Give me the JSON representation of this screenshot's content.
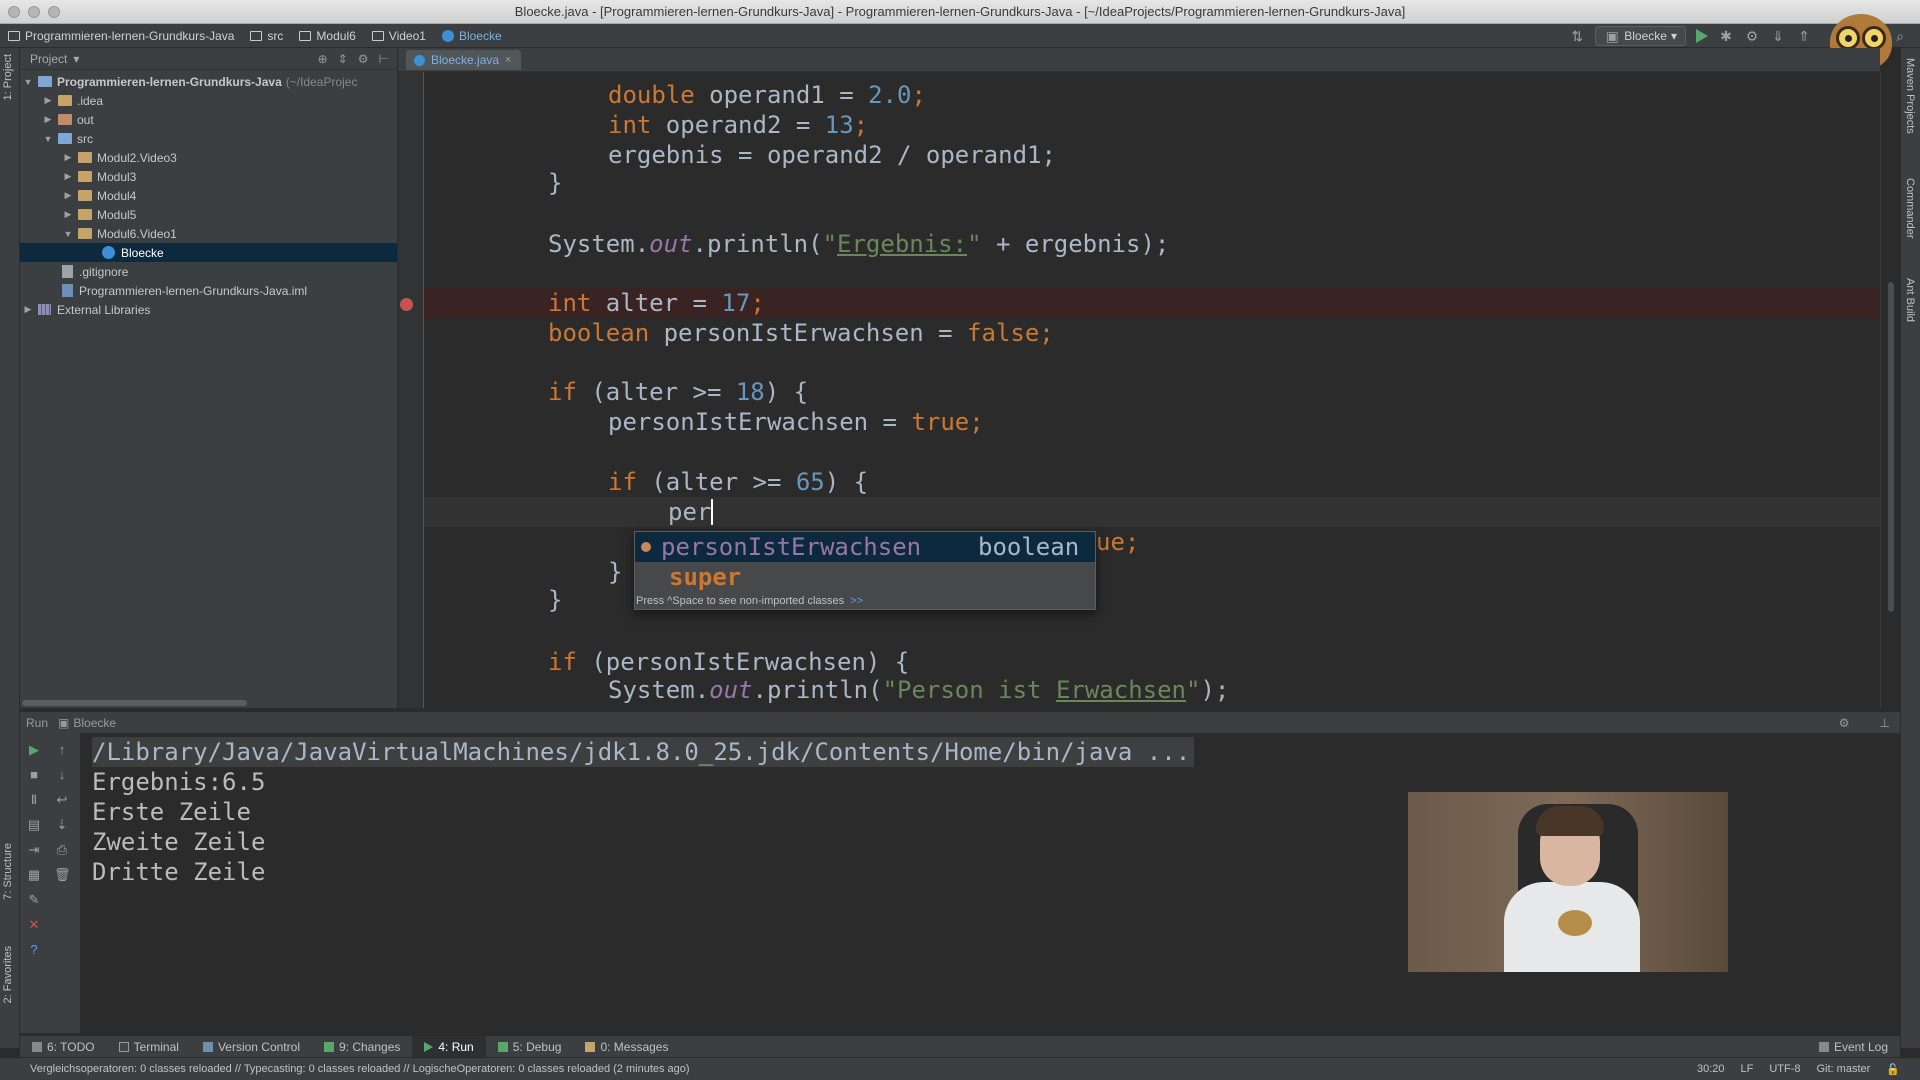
{
  "window": {
    "title": "Bloecke.java - [Programmieren-lernen-Grundkurs-Java] - Programmieren-lernen-Grundkurs-Java - [~/IdeaProjects/Programmieren-lernen-Grundkurs-Java]"
  },
  "navbar": {
    "crumbs": [
      "Programmieren-lernen-Grundkurs-Java",
      "src",
      "Modul6",
      "Video1",
      "Bloecke"
    ],
    "run_config": "Bloecke"
  },
  "left_strip": {
    "project_label": "1: Project",
    "structure_label": "7: Structure",
    "favorites_label": "2: Favorites"
  },
  "right_strip": {
    "maven_label": "Maven Projects",
    "commander_label": "Commander",
    "ant_label": "Ant Build"
  },
  "project": {
    "header_label": "Project",
    "tree": [
      {
        "label": "Programmieren-lernen-Grundkurs-Java",
        "extra": "(~/IdeaProjec"
      },
      {
        "label": ".idea"
      },
      {
        "label": "out"
      },
      {
        "label": "src"
      },
      {
        "label": "Modul2.Video3"
      },
      {
        "label": "Modul3"
      },
      {
        "label": "Modul4"
      },
      {
        "label": "Modul5"
      },
      {
        "label": "Modul6.Video1"
      },
      {
        "label": "Bloecke"
      },
      {
        "label": ".gitignore"
      },
      {
        "label": "Programmieren-lernen-Grundkurs-Java.iml"
      },
      {
        "label": "External Libraries"
      }
    ]
  },
  "editor": {
    "tab_label": "Bloecke.java",
    "code": {
      "l1": {
        "kw": "double",
        "rest": " operand1 = ",
        "num": "2.0",
        "end": ";"
      },
      "l2": {
        "kw": "int",
        "rest": " operand2 = ",
        "num": "13",
        "end": ";"
      },
      "l3": "ergebnis = operand2 / operand1;",
      "l4": "}",
      "l5": {
        "a": "System.",
        "fld": "out",
        "b": ".println(",
        "str1": "\"",
        "strword": "Ergebnis:",
        "str2": "\"",
        "c": " + ergebnis);"
      },
      "l6": {
        "kw": "int",
        "rest": " alter = ",
        "num": "17",
        "end": ";"
      },
      "l7": {
        "kw": "boolean",
        "rest": " personIstErwachsen = ",
        "kw2": "false",
        "end": ";"
      },
      "l8": {
        "kw": "if",
        "rest": " (alter >= ",
        "num": "18",
        "end": ") {"
      },
      "l9": {
        "rest": "personIstErwachsen = ",
        "kw": "true",
        "end": ";"
      },
      "l10": {
        "kw": "if",
        "rest": " (alter >= ",
        "num": "65",
        "end": ") {"
      },
      "l11": "per",
      "l12": {
        "kw": "ue",
        "end": ";"
      },
      "l13": "}",
      "l14": "}",
      "l15": {
        "kw": "if",
        "rest": " (personIstErwachsen) {"
      },
      "l16": {
        "a": "System.",
        "fld": "out",
        "b": ".println(",
        "str1": "\"Person ist ",
        "strword": "Erwachsen",
        "str2": "\"",
        "c": ");"
      }
    },
    "completion": {
      "items": [
        {
          "name": "personIstErwachsen",
          "type": "boolean"
        },
        {
          "name": "super",
          "type": ""
        }
      ],
      "hint": "Press ^Space to see non-imported classes",
      "hint_link": ">>"
    }
  },
  "run": {
    "header_label": "Run",
    "config_label": "Bloecke",
    "console_lines": [
      "/Library/Java/JavaVirtualMachines/jdk1.8.0_25.jdk/Contents/Home/bin/java ...",
      "Ergebnis:6.5",
      "Erste Zeile",
      "Zweite Zeile",
      "Dritte Zeile"
    ]
  },
  "bottom_tabs": {
    "todo": "6: TODO",
    "terminal": "Terminal",
    "vcs": "Version Control",
    "changes": "9: Changes",
    "run": "4: Run",
    "debug": "5: Debug",
    "messages": "0: Messages",
    "event_log": "Event Log"
  },
  "statusbar": {
    "message": "Vergleichsoperatoren: 0 classes reloaded // Typecasting: 0 classes reloaded // LogischeOperatoren: 0 classes reloaded (2 minutes ago)",
    "position": "30:20",
    "line_sep": "LF",
    "encoding": "UTF-8",
    "git": "Git: master"
  }
}
